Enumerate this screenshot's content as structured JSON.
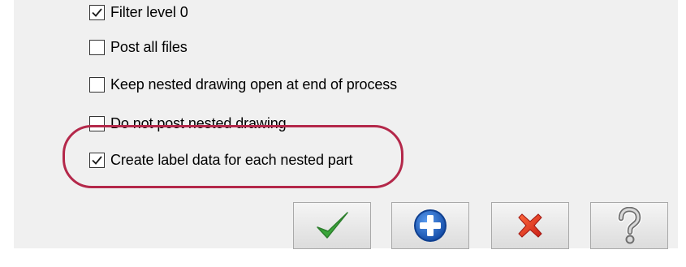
{
  "options": [
    {
      "label": "Filter level 0",
      "checked": true
    },
    {
      "label": "Post all files",
      "checked": false
    },
    {
      "label": "Keep nested drawing open at end of process",
      "checked": false
    },
    {
      "label": "Do not post nested drawing",
      "checked": false
    },
    {
      "label": "Create label data for each nested part",
      "checked": true
    }
  ],
  "highlight_color": "#b4284a",
  "buttons": {
    "ok": {
      "icon": "green-checkmark-icon",
      "color": "#3aa53a"
    },
    "add": {
      "icon": "blue-plus-circle-icon",
      "color": "#1f63c9"
    },
    "cancel": {
      "icon": "red-x-icon",
      "color": "#e23b1e"
    },
    "help": {
      "icon": "question-mark-icon",
      "color": "#6f6f6f"
    }
  }
}
